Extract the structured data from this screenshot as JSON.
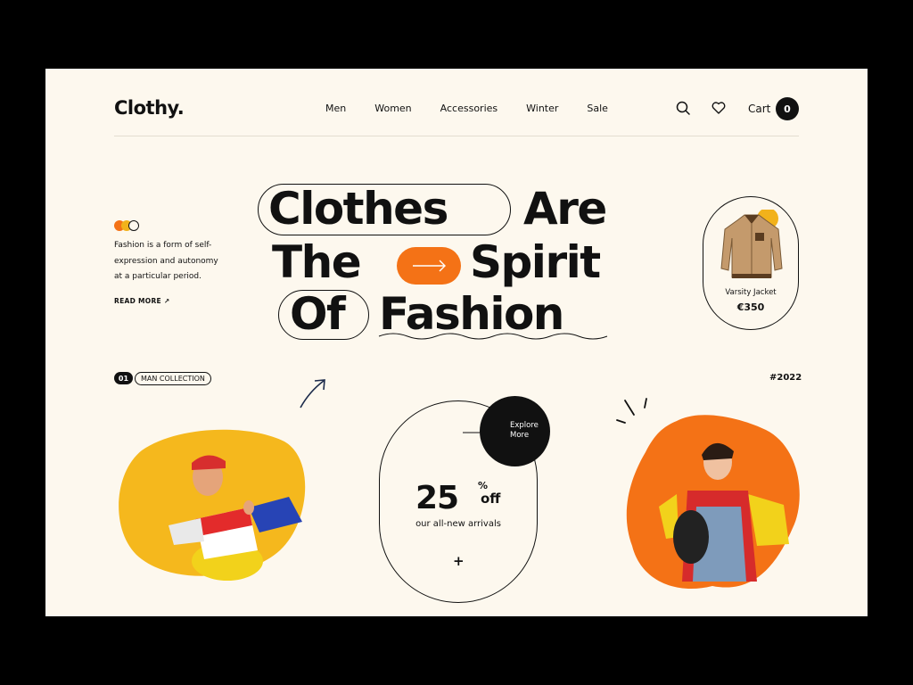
{
  "brand": {
    "logo": "Clothy."
  },
  "nav": {
    "items": [
      "Men",
      "Women",
      "Accessories",
      "Winter",
      "Sale"
    ]
  },
  "header": {
    "cart_label": "Cart",
    "cart_count": "0",
    "icons": [
      "search-icon",
      "heart-icon"
    ]
  },
  "intro": {
    "text": "Fashion is a form of self-expression and autonomy at a particular period.",
    "read_more": "READ MORE ↗"
  },
  "headline": {
    "line1_a": "Clothes",
    "line1_b": "Are",
    "line2_a": "The",
    "line2_b": "Spirit",
    "line3_a": "Of",
    "line3_b": "Fashion"
  },
  "product": {
    "name": "Varsity Jacket",
    "price": "€350"
  },
  "collection": {
    "number": "01",
    "label": "MAN COLLECTION",
    "year": "#2022"
  },
  "promo": {
    "number": "25",
    "percent": "%",
    "off": "off",
    "subtitle": "our all-new arrivals",
    "plus": "+",
    "explore_line1": "Explore",
    "explore_line2": "More"
  },
  "colors": {
    "accent": "#f47216",
    "yellow": "#f2b21b",
    "background": "#fdf8ee",
    "ink": "#111111"
  }
}
